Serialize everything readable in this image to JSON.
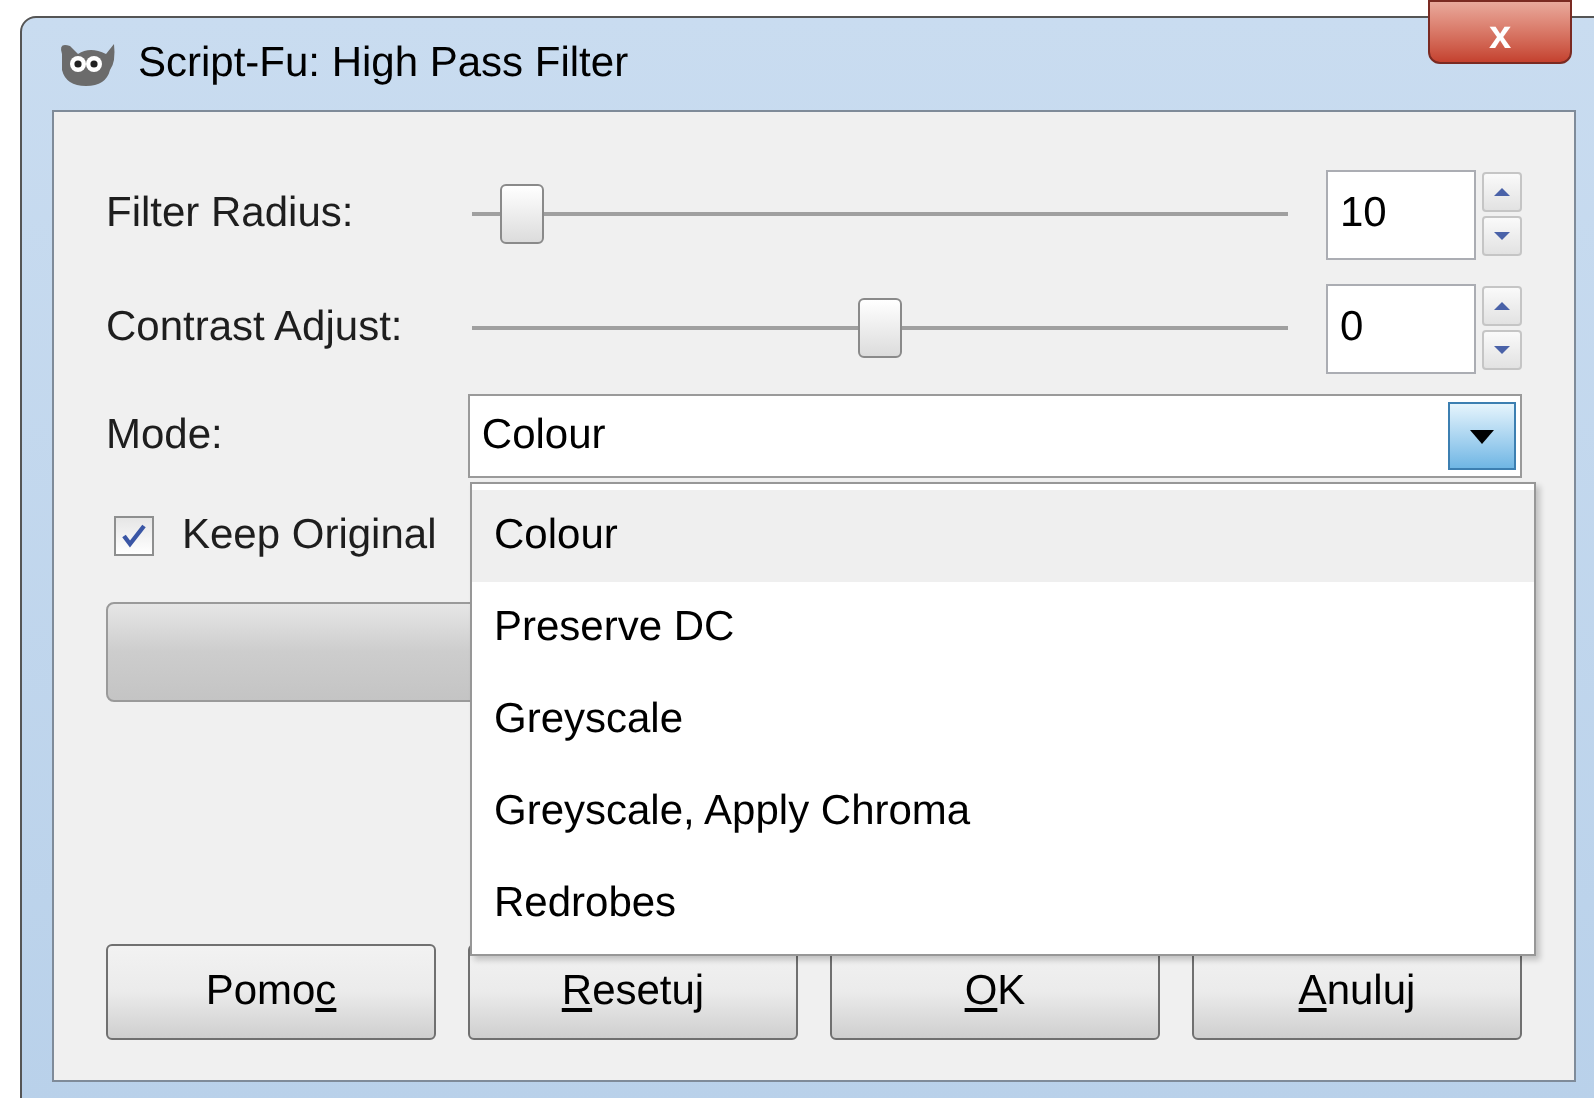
{
  "window": {
    "title": "Script-Fu: High Pass Filter",
    "close": "x"
  },
  "sliders": [
    {
      "label": "Filter Radius:",
      "level": 0.06,
      "value": "10"
    },
    {
      "label": "Contrast Adjust:",
      "level": 0.5,
      "value": "0"
    }
  ],
  "mode": {
    "label": "Mode:",
    "value": "Colour",
    "expanded": true,
    "options": [
      {
        "label": "Colour",
        "selected": true
      },
      {
        "label": "Preserve DC",
        "selected": false
      },
      {
        "label": "Greyscale",
        "selected": false
      },
      {
        "label": "Greyscale, Apply Chroma",
        "selected": false
      },
      {
        "label": "Redrobes",
        "selected": false
      }
    ]
  },
  "keep_original": {
    "label": "Keep Original",
    "checked": true
  },
  "progress": {
    "level": 0
  },
  "buttons": [
    {
      "before": "Pomo",
      "mnemonic": "c"
    },
    {
      "mnemonic": "R",
      "after": "esetuj"
    },
    {
      "mnemonic": "O",
      "after": "K"
    },
    {
      "mnemonic": "A",
      "after": "nuluj"
    }
  ]
}
